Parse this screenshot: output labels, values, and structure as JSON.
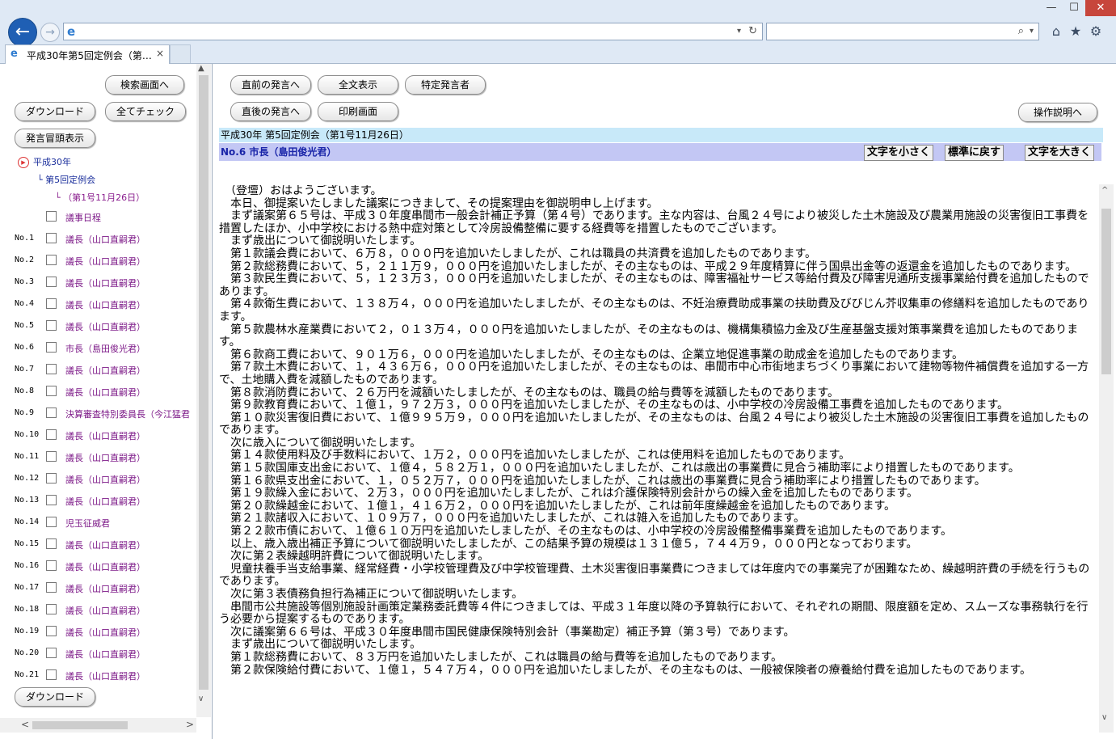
{
  "browser": {
    "tab_title": "平成30年第5回定例会（第…",
    "tab_close": "×",
    "back": "←",
    "forward": "→",
    "ie_glyph": "e",
    "addr_dropdown": "▾",
    "refresh": "↻",
    "search_glyph": "⌕",
    "search_dropdown": "▾",
    "home": "⌂",
    "favorites": "★",
    "tools": "⚙",
    "win_min": "—",
    "win_max": "☐",
    "win_close": "✕"
  },
  "left": {
    "search_screen": "検索画面へ",
    "download": "ダウンロード",
    "check_all": "全てチェック",
    "show_beginning": "発言冒頭表示",
    "tree": {
      "year": "平成30年",
      "session": "└ 第5回定例会",
      "day": "└ （第1号11月26日）",
      "agenda": "議事日程"
    },
    "speakers": [
      {
        "no": "No.1",
        "name": "議長（山口直嗣君）"
      },
      {
        "no": "No.2",
        "name": "議長（山口直嗣君）"
      },
      {
        "no": "No.3",
        "name": "議長（山口直嗣君）"
      },
      {
        "no": "No.4",
        "name": "議長（山口直嗣君）"
      },
      {
        "no": "No.5",
        "name": "議長（山口直嗣君）"
      },
      {
        "no": "No.6",
        "name": "市長（島田俊光君）"
      },
      {
        "no": "No.7",
        "name": "議長（山口直嗣君）"
      },
      {
        "no": "No.8",
        "name": "議長（山口直嗣君）"
      },
      {
        "no": "No.9",
        "name": "決算審査特別委員長（今江猛君"
      },
      {
        "no": "No.10",
        "name": "議長（山口直嗣君）"
      },
      {
        "no": "No.11",
        "name": "議長（山口直嗣君）"
      },
      {
        "no": "No.12",
        "name": "議長（山口直嗣君）"
      },
      {
        "no": "No.13",
        "name": "議長（山口直嗣君）"
      },
      {
        "no": "No.14",
        "name": "児玉征威君"
      },
      {
        "no": "No.15",
        "name": "議長（山口直嗣君）"
      },
      {
        "no": "No.16",
        "name": "議長（山口直嗣君）"
      },
      {
        "no": "No.17",
        "name": "議長（山口直嗣君）"
      },
      {
        "no": "No.18",
        "name": "議長（山口直嗣君）"
      },
      {
        "no": "No.19",
        "name": "議長（山口直嗣君）"
      },
      {
        "no": "No.20",
        "name": "議長（山口直嗣君）"
      },
      {
        "no": "No.21",
        "name": "議長（山口直嗣君）"
      }
    ],
    "download_bottom": "ダウンロード",
    "scroll_up": "▲",
    "scroll_down": "∨",
    "scroll_left": "<",
    "scroll_right": ">"
  },
  "right": {
    "prev_speech": "直前の発言へ",
    "show_all": "全文表示",
    "specific_speaker": "特定発言者",
    "next_speech": "直後の発言へ",
    "print_screen": "印刷画面",
    "help": "操作説明へ",
    "session_info": "平成30年 第5回定例会（第1号11月26日）",
    "speaker": "No.6 市長（島田俊光君）",
    "font_smaller": "文字を小さく",
    "font_normal": "標準に戻す",
    "font_larger": "文字を大きく",
    "scroll_up": "^",
    "scroll_down": "∨",
    "speech": "　（登壇）おはようございます。\n　本日、御提案いたしました議案につきまして、その提案理由を御説明申し上げます。\n　まず議案第６５号は、平成３０年度串間市一般会計補正予算（第４号）であります。主な内容は、台風２４号により被災した土木施設及び農業用施設の災害復旧工事費を措置したほか、小中学校における熱中症対策として冷房設備整備に要する経費等を措置したものでございます。\n　まず歳出について御説明いたします。\n　第１款議会費において、６万８，０００円を追加いたしましたが、これは職員の共済費を追加したものであります。\n　第２款総務費において、５，２１１万９，０００円を追加いたしましたが、その主なものは、平成２９年度精算に伴う国県出金等の返還金を追加したものであります。\n　第３款民生費において、５，１２３万３，０００円を追加いたしましたが、その主なものは、障害福祉サービス等給付費及び障害児通所支援事業給付費を追加したものであります。\n　第４款衛生費において、１３８万４，０００円を追加いたしましたが、その主なものは、不妊治療費助成事業の扶助費及びびじん芥収集車の修繕料を追加したものであります。\n　第５款農林水産業費において２，０１３万４，０００円を追加いたしましたが、その主なものは、機構集積協力金及び生産基盤支援対策事業費を追加したものであります。\n　第６款商工費において、９０１万６，０００円を追加いたしましたが、その主なものは、企業立地促進事業の助成金を追加したものであります。\n　第７款土木費において、１，４３６万６，０００円を追加いたしましたが、その主なものは、串間市中心市街地まちづくり事業において建物等物件補償費を追加する一方で、土地購入費を減額したものであります。\n　第８款消防費において、２６万円を減額いたしましたが、その主なものは、職員の給与費等を減額したものであります。\n　第９款教育費において、１億１，９７２万３，０００円を追加いたしましたが、その主なものは、小中学校の冷房設備工事費を追加したものであります。\n　第１０款災害復旧費において、１億９９５万９，０００円を追加いたしましたが、その主なものは、台風２４号により被災した土木施設の災害復旧工事費を追加したものであります。\n　次に歳入について御説明いたします。\n　第１４款使用料及び手数料において、１万２，０００円を追加いたしましたが、これは使用料を追加したものであります。\n　第１５款国庫支出金において、１億４，５８２万１，０００円を追加いたしましたが、これは歳出の事業費に見合う補助率により措置したものであります。\n　第１６款県支出金において、１，０５２万７，０００円を追加いたしましたが、これは歳出の事業費に見合う補助率により措置したものであります。\n　第１９款繰入金において、２万３，０００円を追加いたしましたが、これは介護保険特別会計からの繰入金を追加したものであります。\n　第２０款繰越金において、１億１，４１６万２，０００円を追加いたしましたが、これは前年度繰越金を追加したものであります。\n　第２１款諸収入において、１０９万７，０００円を追加いたしましたが、これは雑入を追加したものであります。\n　第２２款市債において、１億６１０万円を追加いたしましたが、その主なものは、小中学校の冷房設備整備事業費を追加したものであります。\n　以上、歳入歳出補正予算について御説明いたしましたが、この結果予算の規模は１３１億５，７４４万９，０００円となっております。\n　次に第２表繰越明許費について御説明いたします。\n　児童扶養手当支給事業、経常経費・小学校管理費及び中学校管理費、土木災害復旧事業費につきましては年度内での事業完了が困難なため、繰越明許費の手続を行うものであります。\n　次に第３表債務負担行為補正について御説明いたします。\n　串間市公共施設等個別施設計画策定業務委託費等４件につきましては、平成３１年度以降の予算執行において、それぞれの期間、限度額を定め、スムーズな事務執行を行う必要から提案するものであります。\n　次に議案第６６号は、平成３０年度串間市国民健康保険特別会計（事業勘定）補正予算（第３号）であります。\n　まず歳出について御説明いたします。\n　第１款総務費において、８３万円を追加いたしましたが、これは職員の給与費等を追加したものであります。\n　第２款保険給付費において、１億１，５４７万４，０００円を追加いたしましたが、その主なものは、一般被保険者の療養給付費を追加したものであります。"
  }
}
